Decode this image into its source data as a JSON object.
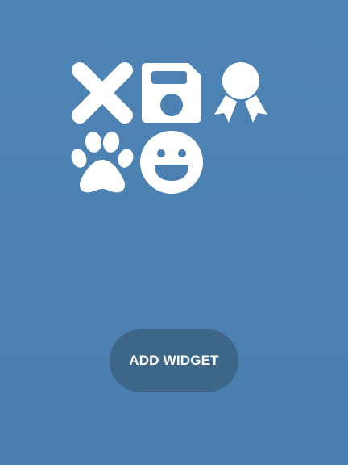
{
  "widget_picker": {
    "icons": [
      {
        "name": "close-icon"
      },
      {
        "name": "save-icon"
      },
      {
        "name": "award-icon"
      },
      {
        "name": "paw-icon"
      },
      {
        "name": "smile-icon"
      }
    ]
  },
  "add_widget_button": {
    "label": "ADD WIDGET"
  },
  "colors": {
    "background": "#4a7fb0",
    "button": "#3d6689",
    "icon": "#ffffff",
    "button_text": "#ffffff"
  }
}
